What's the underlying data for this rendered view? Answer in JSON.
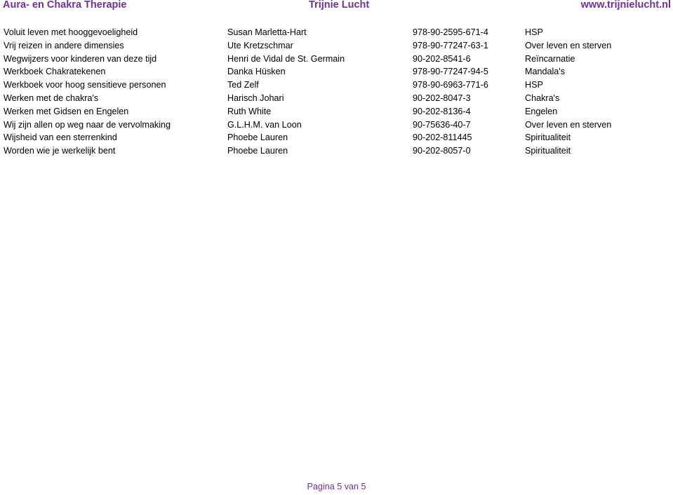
{
  "header": {
    "left": "Aura- en Chakra Therapie",
    "center": "Trijnie Lucht",
    "right": "www.trijnielucht.nl"
  },
  "rows": [
    [
      "Voluit leven met hooggevoeligheid",
      "Susan Marletta-Hart",
      "978-90-2595-671-4",
      "HSP"
    ],
    [
      "Vrij reizen in andere dimensies",
      "Ute Kretzschmar",
      "978-90-77247-63-1",
      "Over leven en sterven"
    ],
    [
      "Wegwijzers voor kinderen van deze tijd",
      "Henri de Vidal de St. Germain",
      "90-202-8541-6",
      "Reïncarnatie"
    ],
    [
      "Werkboek Chakratekenen",
      "Danka Hüsken",
      "978-90-77247-94-5",
      "Mandala's"
    ],
    [
      "Werkboek voor hoog sensitieve personen",
      "Ted Zelf",
      "978-90-6963-771-6",
      "HSP"
    ],
    [
      "Werken met de chakra's",
      "Harisch Johari",
      "90-202-8047-3",
      "Chakra's"
    ],
    [
      "Werken met Gidsen en Engelen",
      "Ruth White",
      "90-202-8136-4",
      "Engelen"
    ],
    [
      "Wij zijn allen op weg naar de vervolmaking",
      "G.L.H.M. van Loon",
      "90-75636-40-7",
      "Over leven en sterven"
    ],
    [
      "Wijsheid van een sterrenkind",
      "Phoebe Lauren",
      "90-202-811445",
      "Spiritualiteit"
    ],
    [
      "Worden wie je werkelijk bent",
      "Phoebe Lauren",
      "90-202-8057-0",
      "Spiritualiteit"
    ]
  ],
  "footer": "Pagina 5 van 5",
  "colors": {
    "accent": "#7030a0"
  }
}
